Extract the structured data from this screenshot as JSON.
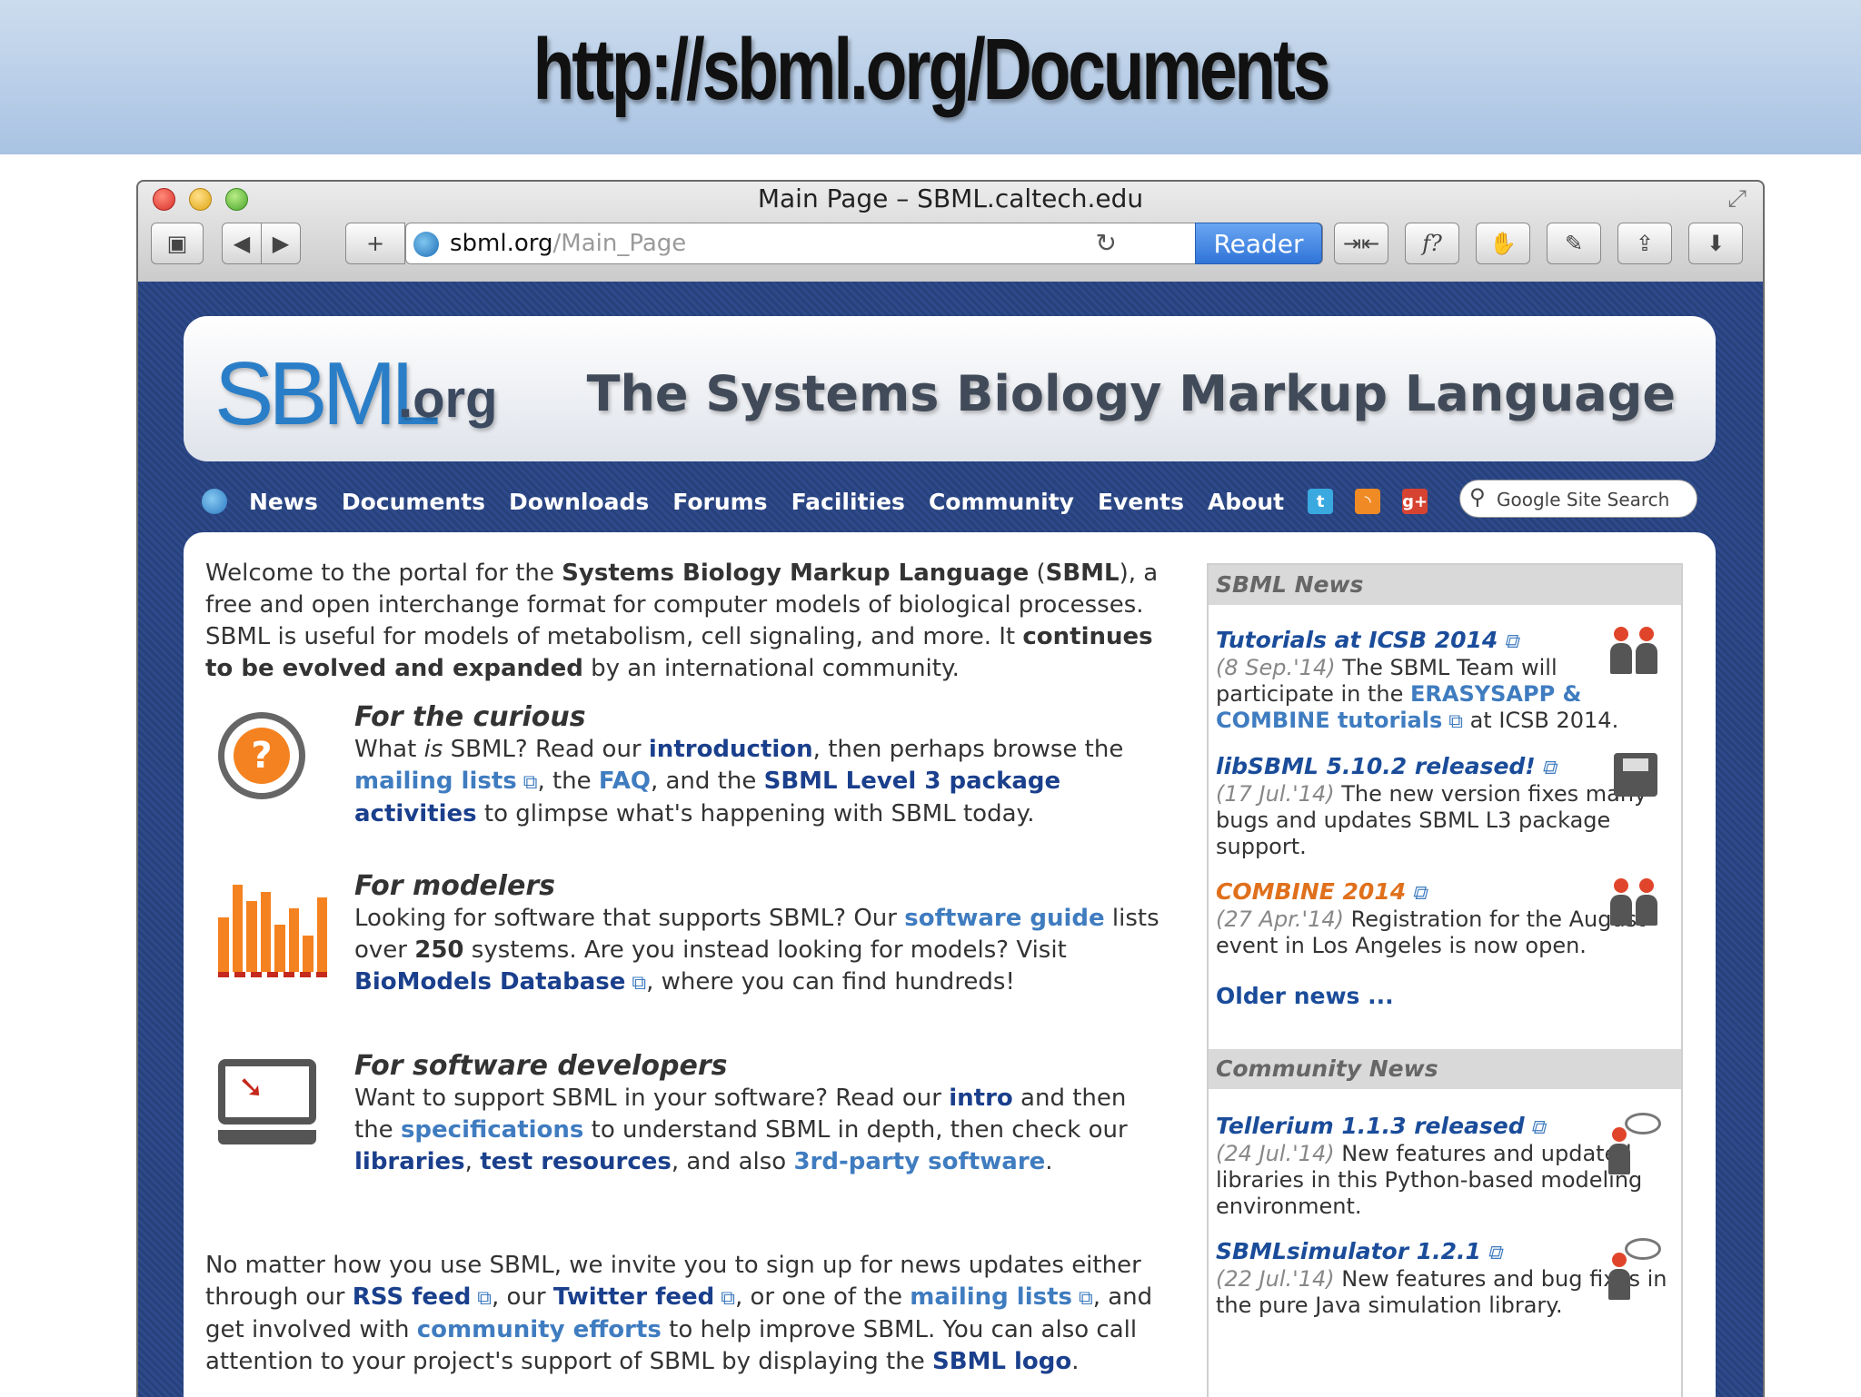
{
  "slide": {
    "title": "http://sbml.org/Documents"
  },
  "window": {
    "title": "Main Page – SBML.caltech.edu",
    "url_host": "sbml.org",
    "url_path": "/Main_Page",
    "reader_label": "Reader",
    "toolbar_icons": [
      "sidebar-icon",
      "back-icon",
      "forward-icon",
      "new-tab-icon",
      "reload-icon",
      "collapse-icon",
      "formula-icon",
      "hand-icon",
      "wrench-icon",
      "share-icon",
      "download-icon"
    ]
  },
  "site": {
    "logo": "SBML",
    "logo_suffix": ".org",
    "tagline": "The Systems Biology Markup Language",
    "nav": [
      "News",
      "Documents",
      "Downloads",
      "Forums",
      "Facilities",
      "Community",
      "Events",
      "About"
    ],
    "social_icons": [
      "twitter-icon",
      "rss-icon",
      "google-plus-icon"
    ],
    "search_placeholder": "Google Site Search"
  },
  "intro": {
    "t1": "Welcome to the portal for the ",
    "b1": "Systems Biology Markup Language",
    "t2": " (",
    "b2": "SBML",
    "t3": "), a free and open interchange format for computer models of biological processes. SBML is useful for models of metabolism, cell signaling, and more. It ",
    "b3": "continues to be evolved and expanded",
    "t4": " by an international community."
  },
  "curious": {
    "heading": "For the curious",
    "t1": "What ",
    "i1": "is",
    "t2": " SBML? Read our ",
    "l1": "introduction",
    "t3": ", then perhaps browse the ",
    "l2": "mailing lists",
    "t4": ", the ",
    "l3": "FAQ",
    "t5": ", and the ",
    "l4": "SBML Level 3 package activities",
    "t6": " to glimpse what's happening with SBML today."
  },
  "modelers": {
    "heading": "For modelers",
    "t1": "Looking for software that supports SBML? Our ",
    "l1": "software guide",
    "t2": " lists over ",
    "b1": "250",
    "t3": " systems. Are you instead looking for models? Visit ",
    "l2": "BioModels Database",
    "t4": ", where you can find hundreds!"
  },
  "developers": {
    "heading": "For software developers",
    "t1": "Want to support SBML in your software? Read our ",
    "l1": "intro",
    "t2": " and then the ",
    "l2": "specifications",
    "t3": " to understand SBML in depth, then check our ",
    "l3": "libraries",
    "t4": ", ",
    "l4": "test resources",
    "t5": ", and also ",
    "l5": "3rd-party software",
    "t6": "."
  },
  "outro": {
    "t1": "No matter how you use SBML, we invite you to sign up for news updates either through our ",
    "l1": "RSS feed",
    "t2": ", our ",
    "l2": "Twitter feed",
    "t3": ", or one of the ",
    "l3": "mailing lists",
    "t4": ", and get involved with ",
    "l4": "community efforts",
    "t5": " to help improve SBML. You can also call attention to your project's support of SBML by displaying the ",
    "l5": "SBML logo",
    "t6": "."
  },
  "sbml_news": {
    "heading": "SBML News",
    "items": [
      {
        "title": "Tutorials at ICSB 2014",
        "date": "(8 Sep.'14)",
        "t1": " The SBML Team will participate in the ",
        "link": "ERASYSAPP & COMBINE tutorials",
        "t2": " at ICSB 2014."
      },
      {
        "title": "libSBML 5.10.2 released!",
        "date": "(17 Jul.'14)",
        "t1": " The new version fixes many bugs and updates SBML L3 package support."
      },
      {
        "title": "COMBINE 2014",
        "date": "(27 Apr.'14)",
        "t1": " Registration for the August event in Los Angeles is now open."
      }
    ],
    "older": "Older news ..."
  },
  "community_news": {
    "heading": "Community News",
    "items": [
      {
        "title": "Tellerium 1.1.3 released",
        "date": "(24 Jul.'14)",
        "t1": " New features and updated libraries in this Python-based modeling environment."
      },
      {
        "title": "SBMLsimulator 1.2.1",
        "date": "(22 Jul.'14)",
        "t1": " New features and bug fixes in the pure Java simulation library."
      }
    ]
  },
  "colors": {
    "nav_bg": "#2b4684",
    "link": "#1a3f8c",
    "link_light": "#3f7cc0",
    "accent_orange": "#f58220"
  }
}
